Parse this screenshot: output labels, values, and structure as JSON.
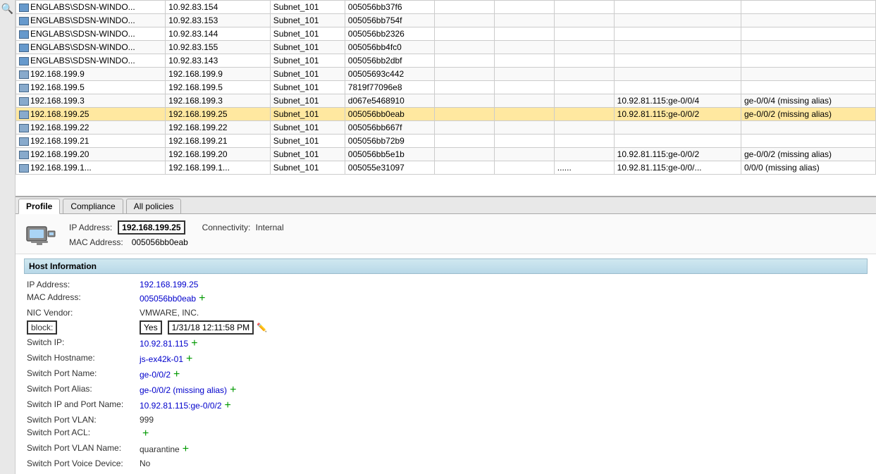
{
  "tableRows": [
    {
      "icon": true,
      "name": "ENGLABS\\SDSN-WINDO...",
      "ip": "10.92.83.154",
      "subnet": "Subnet_101",
      "mac": "005056bb37f6",
      "e1": "",
      "e2": "",
      "e3": "",
      "switchIp": "",
      "switchPort": "",
      "highlighted": false
    },
    {
      "icon": true,
      "name": "ENGLABS\\SDSN-WINDO...",
      "ip": "10.92.83.153",
      "subnet": "Subnet_101",
      "mac": "005056bb754f",
      "e1": "",
      "e2": "",
      "e3": "",
      "switchIp": "",
      "switchPort": "",
      "highlighted": false
    },
    {
      "icon": true,
      "name": "ENGLABS\\SDSN-WINDO...",
      "ip": "10.92.83.144",
      "subnet": "Subnet_101",
      "mac": "005056bb2326",
      "e1": "",
      "e2": "",
      "e3": "",
      "switchIp": "",
      "switchPort": "",
      "highlighted": false
    },
    {
      "icon": true,
      "name": "ENGLABS\\SDSN-WINDO...",
      "ip": "10.92.83.155",
      "subnet": "Subnet_101",
      "mac": "005056bb4fc0",
      "e1": "",
      "e2": "",
      "e3": "",
      "switchIp": "",
      "switchPort": "",
      "highlighted": false
    },
    {
      "icon": true,
      "name": "ENGLABS\\SDSN-WINDO...",
      "ip": "10.92.83.143",
      "subnet": "Subnet_101",
      "mac": "005056bb2dbf",
      "e1": "",
      "e2": "",
      "e3": "",
      "switchIp": "",
      "switchPort": "",
      "highlighted": false
    },
    {
      "icon": false,
      "name": "192.168.199.9",
      "ip": "192.168.199.9",
      "subnet": "Subnet_101",
      "mac": "00505693c442",
      "e1": "",
      "e2": "",
      "e3": "",
      "switchIp": "",
      "switchPort": "",
      "highlighted": false
    },
    {
      "icon": false,
      "name": "192.168.199.5",
      "ip": "192.168.199.5",
      "subnet": "Subnet_101",
      "mac": "7819f77096e8",
      "e1": "",
      "e2": "",
      "e3": "",
      "switchIp": "",
      "switchPort": "",
      "highlighted": false
    },
    {
      "icon": false,
      "name": "192.168.199.3",
      "ip": "192.168.199.3",
      "subnet": "Subnet_101",
      "mac": "d067e5468910",
      "e1": "",
      "e2": "",
      "e3": "",
      "switchIp": "10.92.81.115:ge-0/0/4",
      "switchPort": "ge-0/0/4 (missing alias)",
      "highlighted": false
    },
    {
      "icon": false,
      "name": "192.168.199.25",
      "ip": "192.168.199.25",
      "subnet": "Subnet_101",
      "mac": "005056bb0eab",
      "e1": "",
      "e2": "",
      "e3": "",
      "switchIp": "10.92.81.115:ge-0/0/2",
      "switchPort": "ge-0/0/2 (missing alias)",
      "highlighted": true
    },
    {
      "icon": false,
      "name": "192.168.199.22",
      "ip": "192.168.199.22",
      "subnet": "Subnet_101",
      "mac": "005056bb667f",
      "e1": "",
      "e2": "",
      "e3": "",
      "switchIp": "",
      "switchPort": "",
      "highlighted": false
    },
    {
      "icon": false,
      "name": "192.168.199.21",
      "ip": "192.168.199.21",
      "subnet": "Subnet_101",
      "mac": "005056bb72b9",
      "e1": "",
      "e2": "",
      "e3": "",
      "switchIp": "",
      "switchPort": "",
      "highlighted": false
    },
    {
      "icon": false,
      "name": "192.168.199.20",
      "ip": "192.168.199.20",
      "subnet": "Subnet_101",
      "mac": "005056bb5e1b",
      "e1": "",
      "e2": "",
      "e3": "",
      "switchIp": "10.92.81.115:ge-0/0/2",
      "switchPort": "ge-0/0/2 (missing alias)",
      "highlighted": false
    },
    {
      "icon": false,
      "name": "192.168.199.1...",
      "ip": "192.168.199.1...",
      "subnet": "Subnet_101",
      "mac": "005055e31097",
      "e1": "",
      "e2": "",
      "e3": "......",
      "switchIp": "10.92.81.115:ge-0/0/...",
      "switchPort": "0/0/0 (missing alias)",
      "highlighted": false
    }
  ],
  "tabs": [
    {
      "label": "Profile",
      "active": true
    },
    {
      "label": "Compliance",
      "active": false
    },
    {
      "label": "All policies",
      "active": false
    }
  ],
  "profile": {
    "ipLabel": "IP Address:",
    "ipValue": "192.168.199.25",
    "connectivityLabel": "Connectivity:",
    "connectivityValue": "Internal",
    "macLabel": "MAC Address:",
    "macValue": "005056bb0eab"
  },
  "hostInfo": {
    "title": "Host Information",
    "rows": [
      {
        "label": "IP Address:",
        "value": "192.168.199.25",
        "valueClass": "blue",
        "hasPlus": false
      },
      {
        "label": "MAC Address:",
        "value": "005056bb0eab",
        "valueClass": "blue",
        "hasPlus": true
      },
      {
        "label": "NIC Vendor:",
        "value": "VMWARE, INC.",
        "valueClass": "plain",
        "hasPlus": false
      },
      {
        "label": "block:",
        "value": "Yes",
        "valueClass": "block",
        "hasPlus": false,
        "hasTimestamp": true,
        "timestamp": "1/31/18 12:11:58 PM"
      },
      {
        "label": "Switch IP:",
        "value": "10.92.81.115",
        "valueClass": "blue",
        "hasPlus": true
      },
      {
        "label": "Switch Hostname:",
        "value": "js-ex42k-01",
        "valueClass": "blue",
        "hasPlus": true
      },
      {
        "label": "Switch Port Name:",
        "value": "ge-0/0/2",
        "valueClass": "blue",
        "hasPlus": true
      },
      {
        "label": "Switch Port Alias:",
        "value": "ge-0/0/2 (missing alias)",
        "valueClass": "blue",
        "hasPlus": true
      },
      {
        "label": "Switch IP and Port Name:",
        "value": "10.92.81.115:ge-0/0/2",
        "valueClass": "blue",
        "hasPlus": true
      },
      {
        "label": "Switch Port VLAN:",
        "value": "999",
        "valueClass": "plain",
        "hasPlus": false
      },
      {
        "label": "Switch Port ACL:",
        "value": "",
        "valueClass": "plain",
        "hasPlus": true
      },
      {
        "label": "Switch Port VLAN Name:",
        "value": "quarantine",
        "valueClass": "plain",
        "hasPlus": true
      },
      {
        "label": "Switch Port Voice Device:",
        "value": "No",
        "valueClass": "plain",
        "hasPlus": false
      }
    ]
  }
}
